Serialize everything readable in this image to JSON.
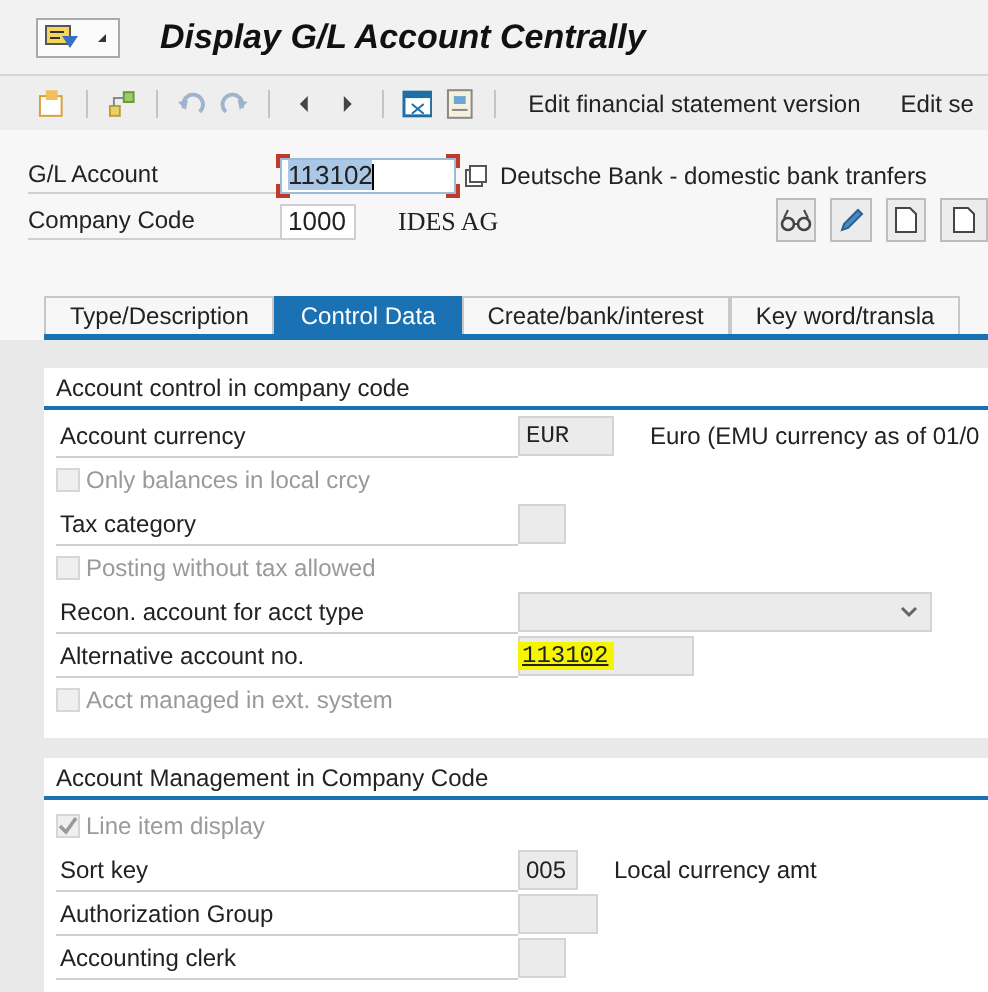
{
  "window": {
    "title": "Display G/L Account Centrally"
  },
  "toolbar": {
    "buttons": [
      "Edit financial statement version",
      "Edit se"
    ]
  },
  "header": {
    "gl_account": {
      "label": "G/L Account",
      "value": "113102",
      "description": "Deutsche Bank - domestic bank tranfers"
    },
    "company_code": {
      "label": "Company Code",
      "value": "1000",
      "description": "IDES AG"
    }
  },
  "tabs": [
    {
      "label": "Type/Description",
      "selected": false
    },
    {
      "label": "Control Data",
      "selected": true
    },
    {
      "label": "Create/bank/interest",
      "selected": false
    },
    {
      "label": "Key word/transla",
      "selected": false
    }
  ],
  "sections": [
    {
      "title": "Account control in company code",
      "rows": [
        {
          "kind": "field",
          "label": "Account currency",
          "value": "EUR",
          "description": "Euro (EMU currency as of 01/0"
        },
        {
          "kind": "checkbox",
          "label": "Only balances in local crcy",
          "checked": false,
          "disabled": true
        },
        {
          "kind": "field",
          "label": "Tax category"
        },
        {
          "kind": "checkbox",
          "label": "Posting without tax allowed",
          "checked": false,
          "disabled": true
        },
        {
          "kind": "dropdown",
          "label": "Recon. account for acct type"
        },
        {
          "kind": "field",
          "label": "Alternative account no.",
          "value": "113102",
          "highlighted": true
        },
        {
          "kind": "checkbox",
          "label": "Acct managed in ext. system",
          "checked": false,
          "disabled": true
        }
      ]
    },
    {
      "title": "Account Management in Company Code",
      "rows": [
        {
          "kind": "checkbox",
          "label": "Line item display",
          "checked": true,
          "disabled": true
        },
        {
          "kind": "field",
          "label": "Sort key",
          "value": "005",
          "description": "Local currency amt"
        },
        {
          "kind": "field",
          "label": "Authorization Group"
        },
        {
          "kind": "field",
          "label": "Accounting clerk"
        }
      ]
    }
  ]
}
